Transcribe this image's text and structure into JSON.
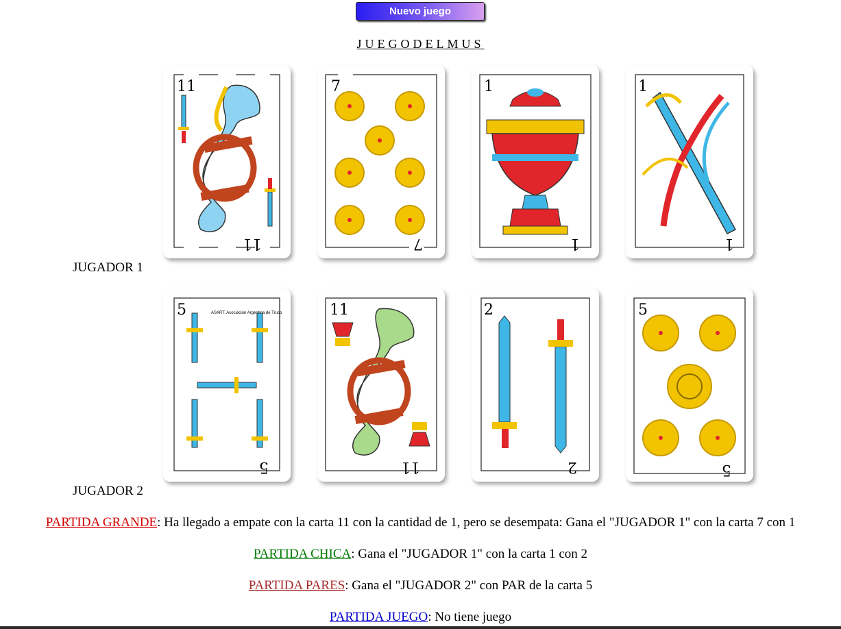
{
  "new_game_button": "Nuevo juego",
  "title": "JUEGODELMUS",
  "players": {
    "p1": "JUGADOR 1",
    "p2": "JUGADOR 2"
  },
  "hands": {
    "p1": [
      {
        "number": "11",
        "suit": "espadas",
        "figure": "caballo"
      },
      {
        "number": "7",
        "suit": "oros"
      },
      {
        "number": "1",
        "suit": "copas"
      },
      {
        "number": "1",
        "suit": "espadas"
      }
    ],
    "p2": [
      {
        "number": "5",
        "suit": "espadas",
        "print": "ASART. Asociación Argentina de Truco"
      },
      {
        "number": "11",
        "suit": "copas",
        "figure": "caballo"
      },
      {
        "number": "2",
        "suit": "espadas"
      },
      {
        "number": "5",
        "suit": "oros"
      }
    ]
  },
  "results": [
    {
      "label": "PARTIDA GRANDE",
      "color": "#d40000",
      "text": ": Ha llegado a empate con la carta 11 con la cantidad de 1, pero se desempata: Gana el \"JUGADOR 1\" con la carta 7 con 1"
    },
    {
      "label": "PARTIDA CHICA",
      "color": "#007a00",
      "text": ": Gana el \"JUGADOR 1\" con la carta 1 con 2"
    },
    {
      "label": "PARTIDA PARES",
      "color": "#a52a2a",
      "text": ": Gana el \"JUGADOR 2\" con PAR de la carta 5"
    },
    {
      "label": "PARTIDA JUEGO",
      "color": "#0000cc",
      "text": ": No tiene juego"
    }
  ],
  "colors": {
    "oro": "#f2c300",
    "sword_blade": "#3fb7e6",
    "cup_red": "#e0262b",
    "horse_blue": "#8fd3f2",
    "horse_green": "#a9d98a"
  }
}
